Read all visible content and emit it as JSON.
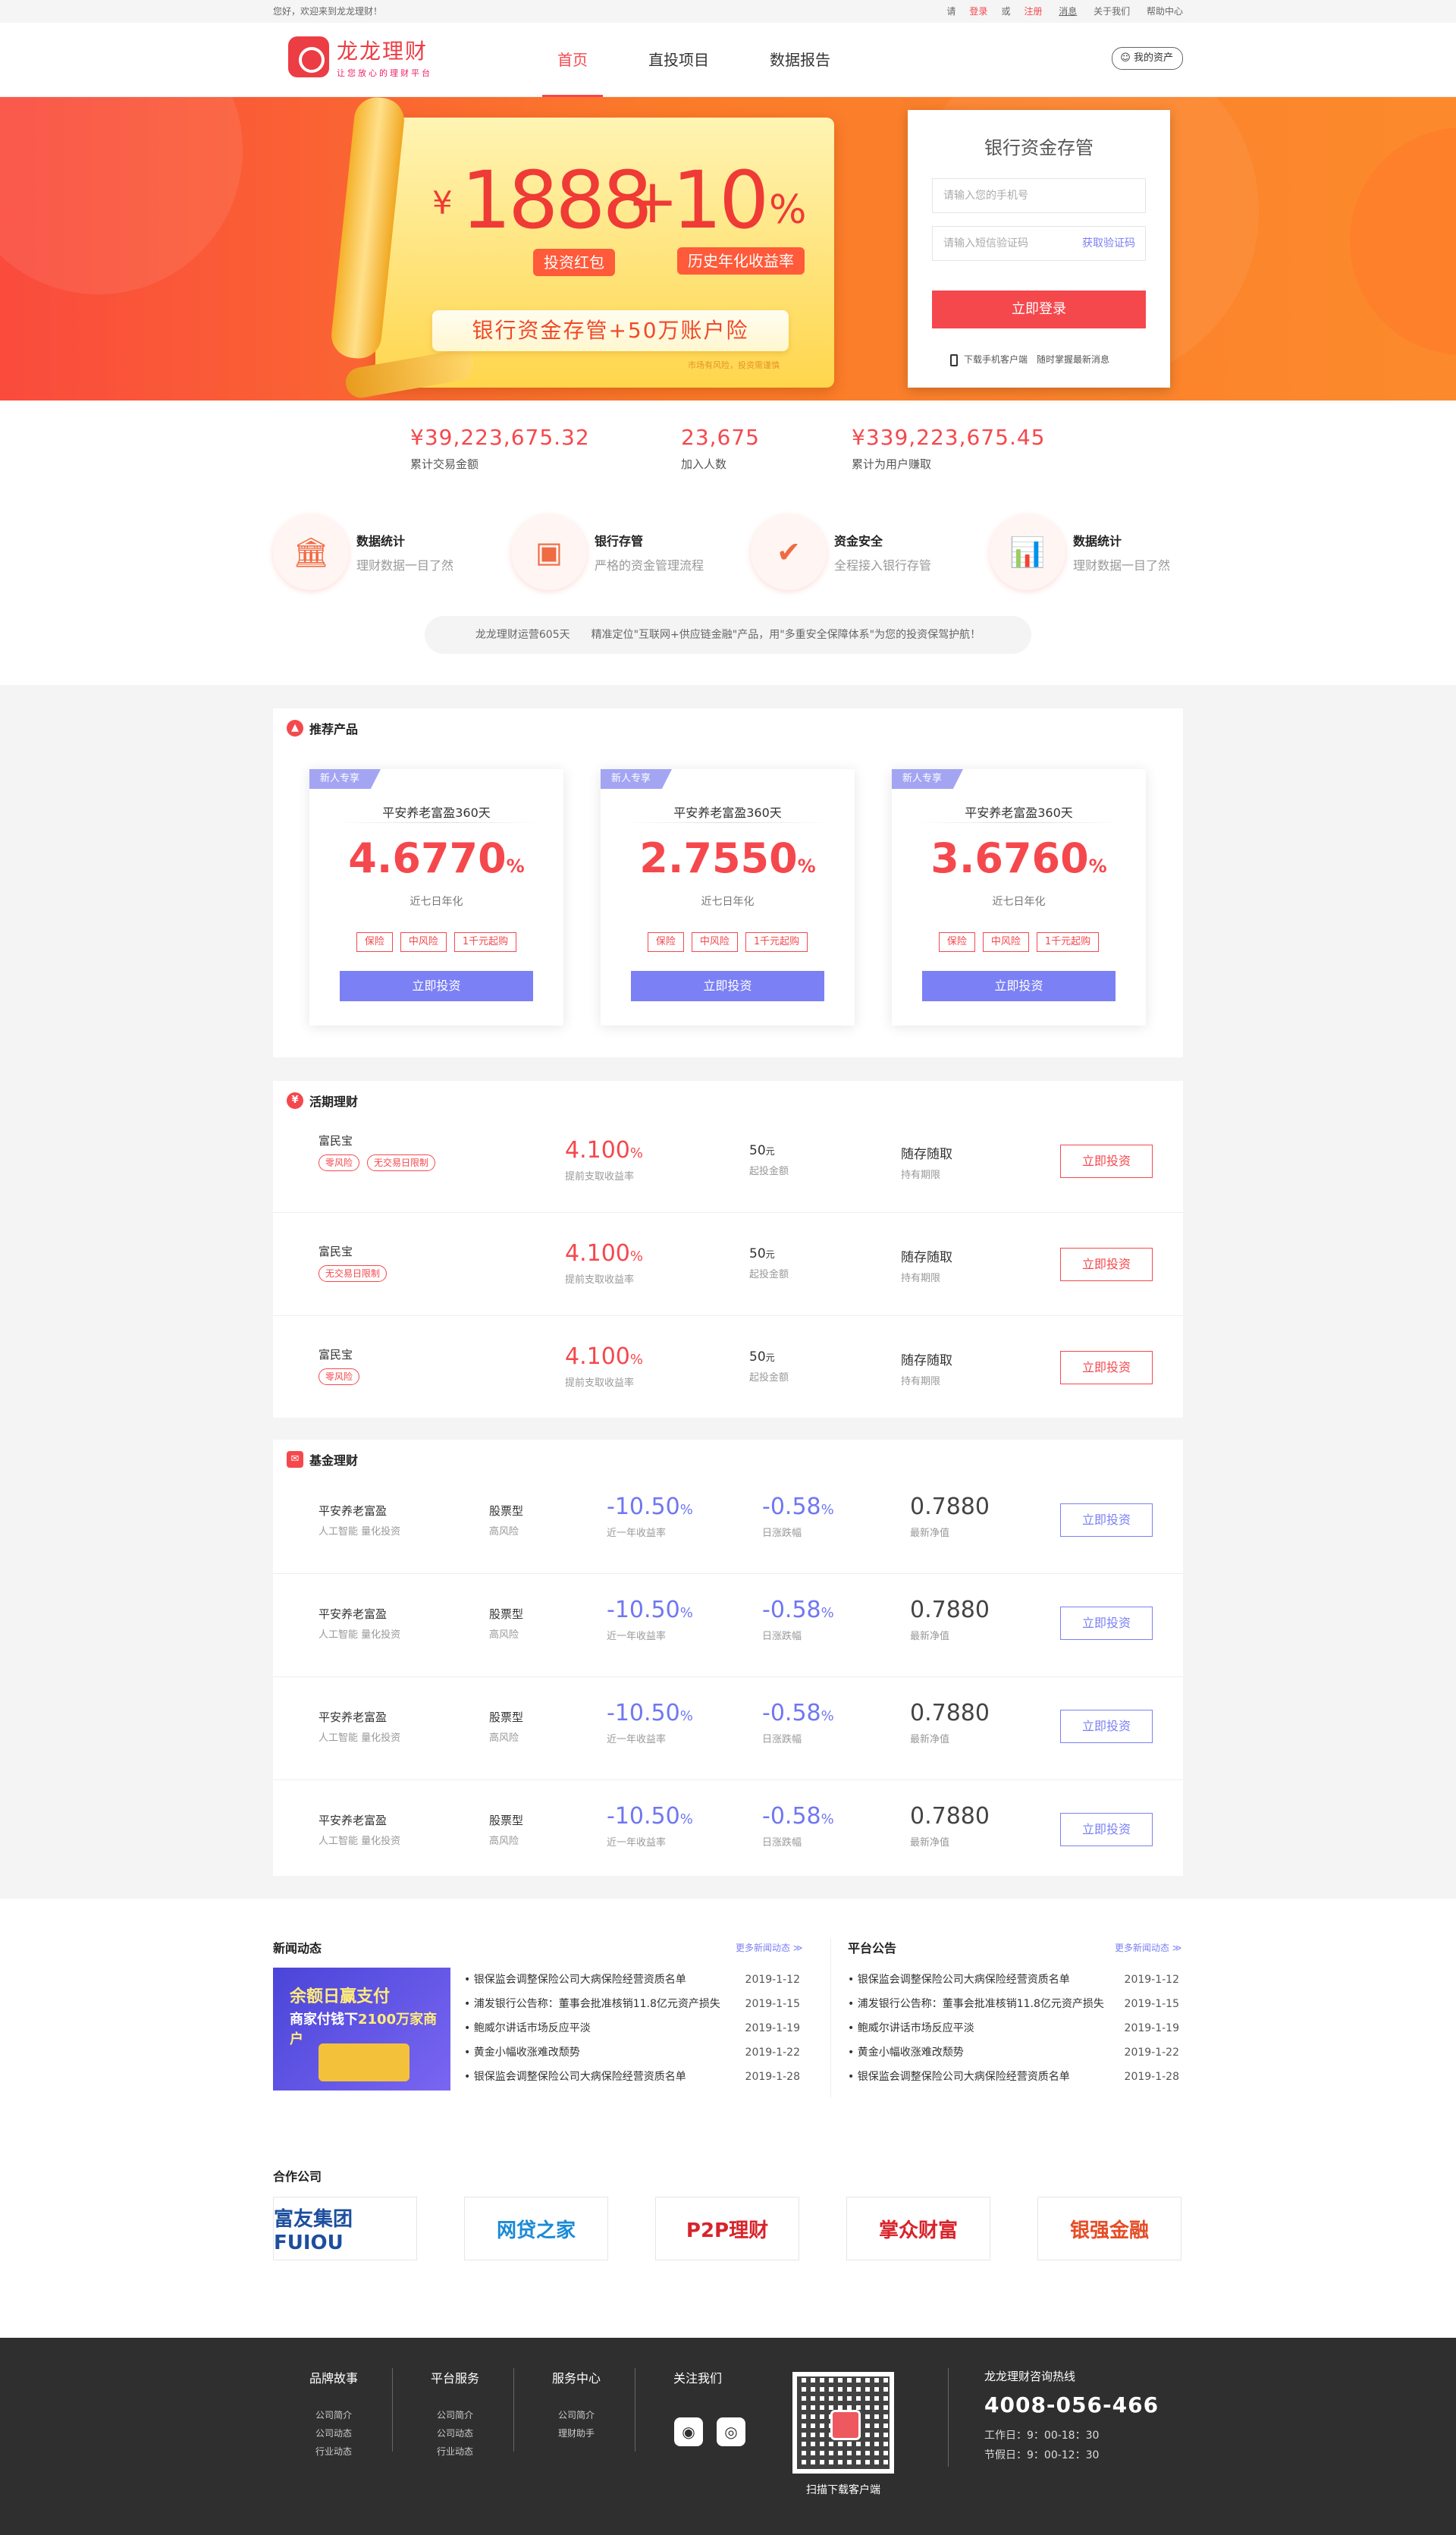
{
  "topbar": {
    "greeting": "您好，欢迎来到龙龙理财！",
    "login_prefix": "请",
    "login": "登录",
    "or": "或",
    "register": "注册",
    "message": "消息",
    "about": "关于我们",
    "help": "帮助中心"
  },
  "header": {
    "logo_title": "龙龙理财",
    "logo_slogan": "让您放心的理财平台",
    "nav": [
      "首页",
      "直投项目",
      "数据报告"
    ],
    "my_assets": "我的资产"
  },
  "banner": {
    "currency": "¥",
    "amount": "1888",
    "plus": "+",
    "rate": "10",
    "percent": "%",
    "pill1": "投资红包",
    "pill2": "历史年化收益率",
    "slogan": "银行资金存管+50万账户险",
    "risk": "市场有风险，投资需谨慎"
  },
  "login_box": {
    "title": "银行资金存管",
    "phone_placeholder": "请输入您的手机号",
    "sms_placeholder": "请输入短信验证码",
    "get_code": "获取验证码",
    "submit": "立即登录",
    "download": "下载手机客户端　随时掌握最新消息"
  },
  "stats": [
    {
      "value": "¥39,223,675.32",
      "label": "累计交易金额"
    },
    {
      "value": "23,675",
      "label": "加入人数"
    },
    {
      "value": "¥339,223,675.45",
      "label": "累计为用户赚取"
    }
  ],
  "features": [
    {
      "icon": "bank-icon",
      "title": "数据统计",
      "desc": "理财数据一目了然"
    },
    {
      "icon": "safe-icon",
      "title": "银行存管",
      "desc": "严格的资金管理流程"
    },
    {
      "icon": "shield-icon",
      "title": "资金安全",
      "desc": "全程接入银行存管"
    },
    {
      "icon": "chart-icon",
      "title": "数据统计",
      "desc": "理财数据一目了然"
    }
  ],
  "notice": "龙龙理财运营605天　　精准定位\"互联网+供应链金融\"产品，用\"多重安全保障体系\"为您的投资保驾护航！",
  "recommend": {
    "title": "推荐产品",
    "cards": [
      {
        "tag": "新人专享",
        "name": "平安养老富盈360天",
        "rate": "4.6770",
        "unit": "%",
        "sub": "近七日年化",
        "tags": [
          "保险",
          "中风险",
          "1千元起购"
        ],
        "button": "立即投资"
      },
      {
        "tag": "新人专享",
        "name": "平安养老富盈360天",
        "rate": "2.7550",
        "unit": "%",
        "sub": "近七日年化",
        "tags": [
          "保险",
          "中风险",
          "1千元起购"
        ],
        "button": "立即投资"
      },
      {
        "tag": "新人专享",
        "name": "平安养老富盈360天",
        "rate": "3.6760",
        "unit": "%",
        "sub": "近七日年化",
        "tags": [
          "保险",
          "中风险",
          "1千元起购"
        ],
        "button": "立即投资"
      }
    ]
  },
  "current": {
    "title": "活期理财",
    "rows": [
      {
        "name": "富民宝",
        "chips": [
          "零风险",
          "无交易日限制"
        ],
        "rate": "4.100",
        "unit": "%",
        "rate_label": "提前支取收益率",
        "min": "50",
        "min_unit": "元",
        "min_label": "起投金额",
        "term": "随存随取",
        "term_label": "持有期限",
        "button": "立即投资"
      },
      {
        "name": "富民宝",
        "chips": [
          "无交易日限制"
        ],
        "rate": "4.100",
        "unit": "%",
        "rate_label": "提前支取收益率",
        "min": "50",
        "min_unit": "元",
        "min_label": "起投金额",
        "term": "随存随取",
        "term_label": "持有期限",
        "button": "立即投资"
      },
      {
        "name": "富民宝",
        "chips": [
          "零风险"
        ],
        "rate": "4.100",
        "unit": "%",
        "rate_label": "提前支取收益率",
        "min": "50",
        "min_unit": "元",
        "min_label": "起投金额",
        "term": "随存随取",
        "term_label": "持有期限",
        "button": "立即投资"
      }
    ]
  },
  "fund": {
    "title": "基金理财",
    "rows": [
      {
        "name": "平安养老富盈",
        "desc": "人工智能 量化投资",
        "type": "股票型",
        "risk": "高风险",
        "year": "-10.50",
        "year_label": "近一年收益率",
        "day": "-0.58",
        "day_label": "日涨跌幅",
        "nav": "0.7880",
        "nav_label": "最新净值",
        "button": "立即投资"
      },
      {
        "name": "平安养老富盈",
        "desc": "人工智能 量化投资",
        "type": "股票型",
        "risk": "高风险",
        "year": "-10.50",
        "year_label": "近一年收益率",
        "day": "-0.58",
        "day_label": "日涨跌幅",
        "nav": "0.7880",
        "nav_label": "最新净值",
        "button": "立即投资"
      },
      {
        "name": "平安养老富盈",
        "desc": "人工智能 量化投资",
        "type": "股票型",
        "risk": "高风险",
        "year": "-10.50",
        "year_label": "近一年收益率",
        "day": "-0.58",
        "day_label": "日涨跌幅",
        "nav": "0.7880",
        "nav_label": "最新净值",
        "button": "立即投资"
      },
      {
        "name": "平安养老富盈",
        "desc": "人工智能 量化投资",
        "type": "股票型",
        "risk": "高风险",
        "year": "-10.50",
        "year_label": "近一年收益率",
        "day": "-0.58",
        "day_label": "日涨跌幅",
        "nav": "0.7880",
        "nav_label": "最新净值",
        "button": "立即投资"
      }
    ],
    "unit": "%"
  },
  "news": {
    "title": "新闻动态",
    "more": "更多新闻动态 ≫",
    "image_line1": "余额日赢支付",
    "image_line2a": "商家付钱下",
    "image_line2b": "2100万家商户",
    "items": [
      {
        "text": "银保监会调整保险公司大病保险经营资质名单",
        "date": "2019-1-12"
      },
      {
        "text": "浦发银行公告称：董事会批准核销11.8亿元资产损失",
        "date": "2019-1-15"
      },
      {
        "text": "鲍威尔讲话市场反应平淡",
        "date": "2019-1-19"
      },
      {
        "text": "黄金小幅收涨难改颓势",
        "date": "2019-1-22"
      },
      {
        "text": "银保监会调整保险公司大病保险经营资质名单",
        "date": "2019-1-28"
      }
    ]
  },
  "announcements": {
    "title": "平台公告",
    "more": "更多新闻动态 ≫",
    "items": [
      {
        "text": "银保监会调整保险公司大病保险经营资质名单",
        "date": "2019-1-12"
      },
      {
        "text": "浦发银行公告称：董事会批准核销11.8亿元资产损失",
        "date": "2019-1-15"
      },
      {
        "text": "鲍威尔讲话市场反应平淡",
        "date": "2019-1-19"
      },
      {
        "text": "黄金小幅收涨难改颓势",
        "date": "2019-1-22"
      },
      {
        "text": "银保监会调整保险公司大病保险经营资质名单",
        "date": "2019-1-28"
      }
    ]
  },
  "partners": {
    "title": "合作公司",
    "items": [
      {
        "name": "富友集团 FUIOU",
        "color": "#1d4e9e"
      },
      {
        "name": "网贷之家",
        "color": "#1a8ad6"
      },
      {
        "name": "P2P理财",
        "color": "#d8232a"
      },
      {
        "name": "掌众财富",
        "color": "#d8232a"
      },
      {
        "name": "银强金融",
        "color": "#e44d26"
      }
    ]
  },
  "footer": {
    "cols": [
      {
        "title": "品牌故事",
        "items": [
          "公司简介",
          "公司动态",
          "行业动态"
        ]
      },
      {
        "title": "平台服务",
        "items": [
          "公司简介",
          "公司动态",
          "行业动态"
        ]
      },
      {
        "title": "服务中心",
        "items": [
          "公司简介",
          "理财助手"
        ]
      }
    ],
    "follow": "关注我们",
    "qr_caption": "扫描下载客户端",
    "hotline_title": "龙龙理财咨询热线",
    "hotline": "4008-056-466",
    "workday": "工作日：9：00-18：30",
    "holiday": "节假日：9：00-12：30"
  },
  "colors": {
    "accent": "#f5484d",
    "purple": "#7b80f4",
    "banner_orange": "#fb7a2a"
  }
}
